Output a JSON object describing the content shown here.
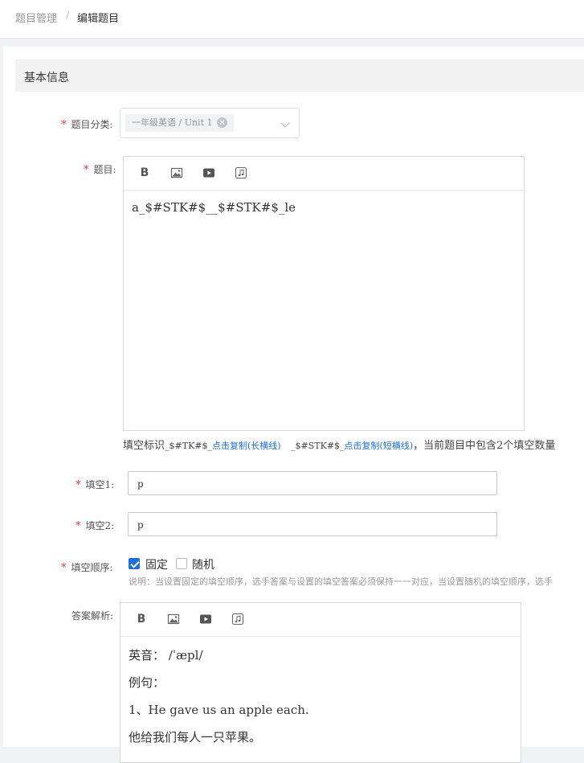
{
  "breadcrumb": {
    "parent": "题目管理",
    "separator": "/",
    "current": "编辑题目"
  },
  "section": {
    "title": "基本信息"
  },
  "form": {
    "required_mark": "*",
    "category": {
      "label": "题目分类:",
      "tag": "一年级英语 / Unit 1",
      "tag_close": "×"
    },
    "question": {
      "label": "题目:",
      "toolbar": {
        "bold": "B"
      },
      "content": "a_$#STK#$__$#STK#$_le"
    },
    "hint": {
      "prefix": "填空标识",
      "long_mark": "_$#TK#$_",
      "copy_long": "点击复制(长横线)",
      "short_mark": "_$#STK#$_",
      "copy_short": "点击复制(短横线)",
      "suffix": "，当前题目中包含2个填空数量"
    },
    "blank1": {
      "label": "填空1:",
      "value": "p"
    },
    "blank2": {
      "label": "填空2:",
      "value": "p"
    },
    "order": {
      "label": "填空顺序:",
      "fixed": "固定",
      "fixed_checked": true,
      "random": "随机",
      "random_checked": false,
      "note": "说明：当设置固定的填空顺序，选手答案与设置的填空答案必须保持一一对应，当设置随机的填空顺序，选手"
    },
    "analysis": {
      "label": "答案解析:",
      "toolbar": {
        "bold": "B"
      },
      "lines": [
        "英音： /ˈæpl/",
        "例句：",
        "1、He gave us an apple each.",
        "他给我们每人一只苹果。"
      ]
    }
  },
  "colors": {
    "accent": "#1e6fd9",
    "required": "#e53935"
  }
}
